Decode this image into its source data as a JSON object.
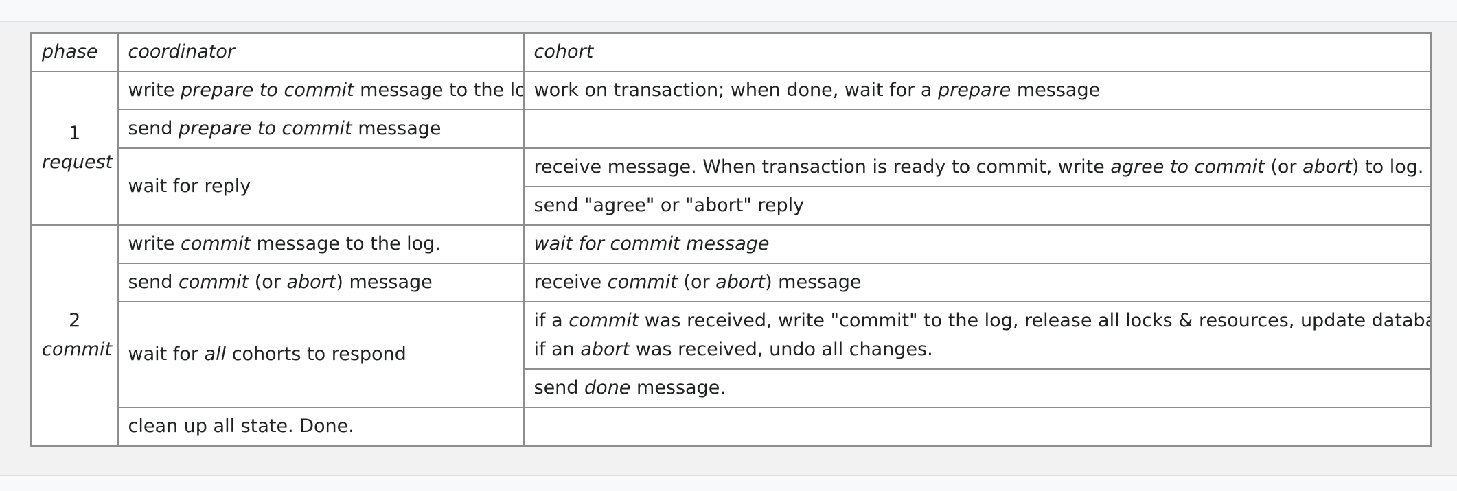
{
  "headers": {
    "phase": "phase",
    "coordinator": "coordinator",
    "cohort": "cohort"
  },
  "phases": [
    {
      "number": "1",
      "name": "request"
    },
    {
      "number": "2",
      "name": "commit"
    }
  ],
  "rows": {
    "r1": {
      "c1": "write",
      "c2": "prepare to commit",
      "c3": "message to the log",
      "h1": "work on transaction; when done, wait for a",
      "h2": "prepare",
      "h3": "message"
    },
    "r2": {
      "c1": "send",
      "c2": "prepare to commit",
      "c3": "message"
    },
    "r3": {
      "c1": "wait for reply",
      "h1": "receive message. When transaction is ready to commit, write",
      "h2": "agree to commit",
      "h3": "(or",
      "h4": "abort",
      "h5": ") to log."
    },
    "r4": {
      "h1": "send \"agree\" or \"abort\" reply"
    },
    "r5": {
      "c1": "write",
      "c2": "commit",
      "c3": "message to the log.",
      "h1": "wait for commit message"
    },
    "r6": {
      "c1": "send",
      "c2": "commit",
      "c3": "(or",
      "c4": "abort",
      "c5": ") message",
      "h1": "receive",
      "h2": "commit",
      "h3": "(or",
      "h4": "abort",
      "h5": ") message"
    },
    "r7": {
      "c1": "wait for",
      "c2": "all",
      "c3": "cohorts to respond",
      "h1": "if a",
      "h2": "commit",
      "h3": "was received, write \"commit\" to the log, release all locks & resources, update databases.",
      "h4": "if an",
      "h5": "abort",
      "h6": "was received, undo all changes."
    },
    "r8": {
      "h1": "send",
      "h2": "done",
      "h3": "message."
    },
    "r9": {
      "c1": "clean up all state. Done."
    }
  }
}
